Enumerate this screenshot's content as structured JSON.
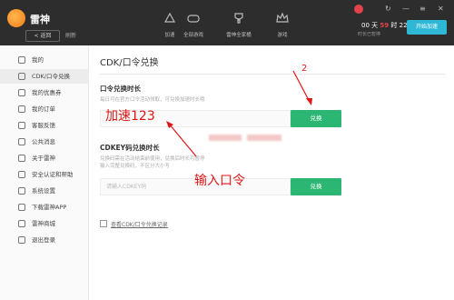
{
  "app": {
    "name": "雷神"
  },
  "topbar": {
    "back_label": "< 返回",
    "refresh_label": "刷新",
    "nav": [
      {
        "label": "加速",
        "icon": "rocket-icon"
      },
      {
        "label": "全部游戏",
        "icon": "gamepad-icon"
      },
      {
        "label": "雷神全家桶",
        "icon": "trophy-icon"
      },
      {
        "label": "游戏",
        "icon": "crown-icon"
      }
    ],
    "timer": {
      "d": "00",
      "h": "59",
      "m": "22"
    },
    "timer_sub": "时长已暂停",
    "open_button": "开始加速"
  },
  "sidebar": {
    "items": [
      {
        "label": "我的",
        "icon": "user-icon"
      },
      {
        "label": "CDK/口令兑换",
        "icon": "ticket-icon"
      },
      {
        "label": "我的优惠券",
        "icon": "coupon-icon"
      },
      {
        "label": "我的订单",
        "icon": "order-icon"
      },
      {
        "label": "客服反馈",
        "icon": "headset-icon"
      },
      {
        "label": "公共消息",
        "icon": "message-icon"
      },
      {
        "label": "关于雷神",
        "icon": "info-icon"
      },
      {
        "label": "安全认证和帮助",
        "icon": "shield-icon"
      },
      {
        "label": "系统设置",
        "icon": "gear-icon"
      },
      {
        "label": "下载雷神APP",
        "icon": "download-icon"
      },
      {
        "label": "雷神商城",
        "icon": "shop-icon"
      },
      {
        "label": "退出登录",
        "icon": "logout-icon"
      }
    ]
  },
  "main": {
    "title": "CDK/口令兑换",
    "section1": {
      "title": "口令兑换时长",
      "desc": "每日可在官方口令活动领取，可兑换加速时长哦",
      "placeholder": "",
      "button": "兑换"
    },
    "section2": {
      "title": "CDKEY码兑换时长",
      "desc1": "兑换码需在活动结束前使用，兑换后时长可暂停",
      "desc2": "输入完整兑换码，不区分大小写",
      "placeholder": "请输入CDKEY码",
      "button": "兑换"
    },
    "record_link": "查看CDK/口令兑换记录"
  },
  "annotations": {
    "a": "加速123",
    "b": "输入口令",
    "c": "2"
  }
}
